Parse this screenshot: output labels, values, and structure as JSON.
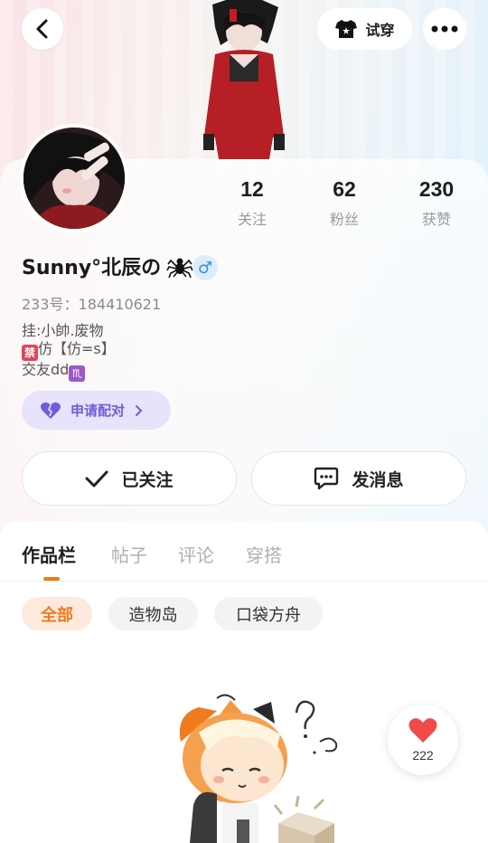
{
  "header": {
    "try_on_label": "试穿"
  },
  "stats": [
    {
      "value": "12",
      "label": "关注"
    },
    {
      "value": "62",
      "label": "粉丝"
    },
    {
      "value": "230",
      "label": "获赞"
    }
  ],
  "profile": {
    "name": "Sunny°北辰の",
    "gender_symbol": "♂",
    "uid": "233号：184410621",
    "bio_line1": "挂:小帥.废物",
    "bio_line2_emoji": "禁",
    "bio_line2_text": "仿【仿=s】",
    "bio_line3_text": "交友dd",
    "bio_line3_emoji": "♏"
  },
  "actions": {
    "pair_label": "申请配对",
    "follow_label": "已关注",
    "message_label": "发消息"
  },
  "tabs": [
    "作品栏",
    "帖子",
    "评论",
    "穿搭"
  ],
  "filters": [
    "全部",
    "造物岛",
    "口袋方舟"
  ],
  "like": {
    "count": "222"
  },
  "colors": {
    "accent": "#f07a1c",
    "pair_purple": "#6d5fd6",
    "gender_blue": "#2f8ee8"
  }
}
